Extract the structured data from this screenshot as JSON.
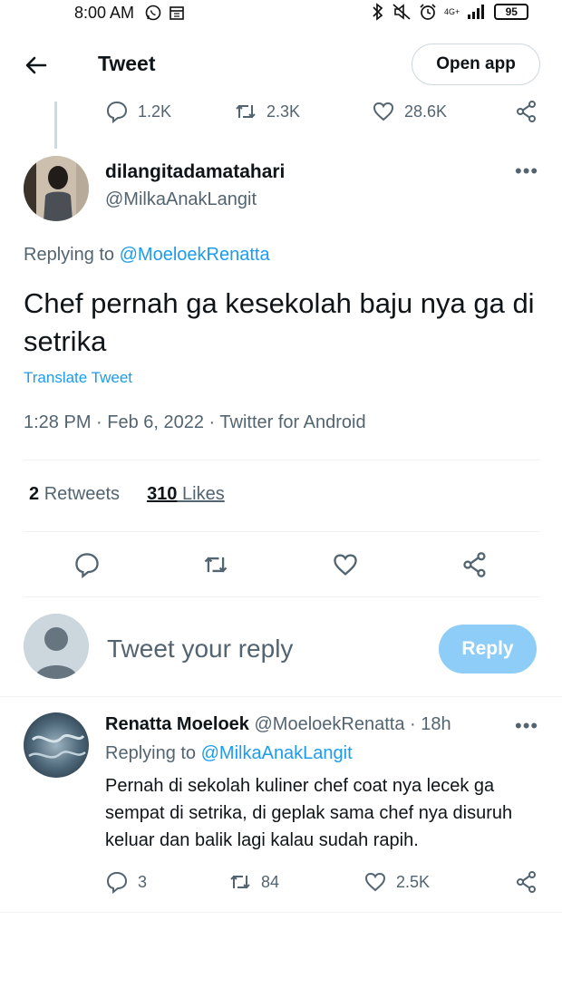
{
  "status_bar": {
    "time": "8:00 AM",
    "network": "4G+",
    "battery": "95"
  },
  "header": {
    "title": "Tweet",
    "open_app": "Open app"
  },
  "parent_metrics": {
    "replies": "1.2K",
    "retweets": "2.3K",
    "likes": "28.6K"
  },
  "tweet": {
    "display_name": "dilangitadamatahari",
    "handle": "@MilkaAnakLangit",
    "replying_prefix": "Replying to",
    "replying_to": "@MoeloekRenatta",
    "text": "Chef pernah ga kesekolah baju nya ga di setrika",
    "translate": "Translate Tweet",
    "timestamp": "1:28 PM · Feb 6, 2022 · Twitter for Android",
    "retweets_count": "2",
    "retweets_label": "Retweets",
    "likes_count": "310",
    "likes_label": "Likes"
  },
  "reply_composer": {
    "placeholder": "Tweet your reply",
    "button": "Reply"
  },
  "reply": {
    "display_name": "Renatta Moeloek",
    "handle": "@MoeloekRenatta",
    "time": "· 18h",
    "replying_prefix": "Replying to",
    "replying_to": "@MilkaAnakLangit",
    "text": "Pernah di sekolah kuliner chef coat nya lecek ga sempat di setrika, di geplak sama chef nya disuruh keluar dan balik lagi kalau sudah rapih.",
    "replies": "3",
    "retweets": "84",
    "likes": "2.5K"
  },
  "colors": {
    "accent": "#1d9bf0",
    "reply_button": "#8ecdf8",
    "muted": "#536471"
  }
}
